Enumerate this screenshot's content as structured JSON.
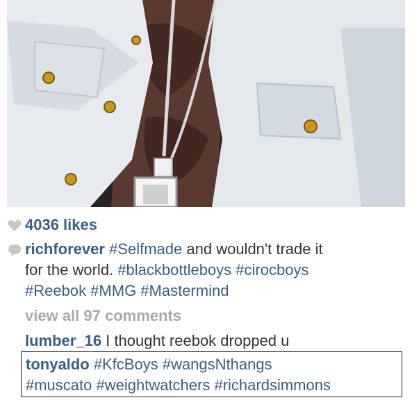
{
  "post": {
    "likes_count": "4036 likes"
  },
  "caption": {
    "username": "richforever",
    "line1_tag": "#Selfmade",
    "line1_rest": " and wouldn't trade it",
    "line2_prefix": "for the world. ",
    "line2_tags": "#blackbottleboys #cirocboys",
    "line3_tags": "#Reebok #MMG #Mastermind"
  },
  "comments_link": "view all 97 comments",
  "comments": [
    {
      "username": "lumber_16",
      "text": " I thought reebok dropped u"
    },
    {
      "username": "tonyaldo",
      "line1_tags": " #KfcBoys #wangsNthangs",
      "line2_tags": "#muscato #weightwatchers #richardsimmons"
    }
  ],
  "icons": {
    "likes": "heart-icon",
    "caption": "speech-bubble-icon"
  },
  "colors": {
    "link": "#3b5e86",
    "text": "#333333",
    "muted": "#a9a9a9",
    "icon": "#c8c8c8"
  }
}
